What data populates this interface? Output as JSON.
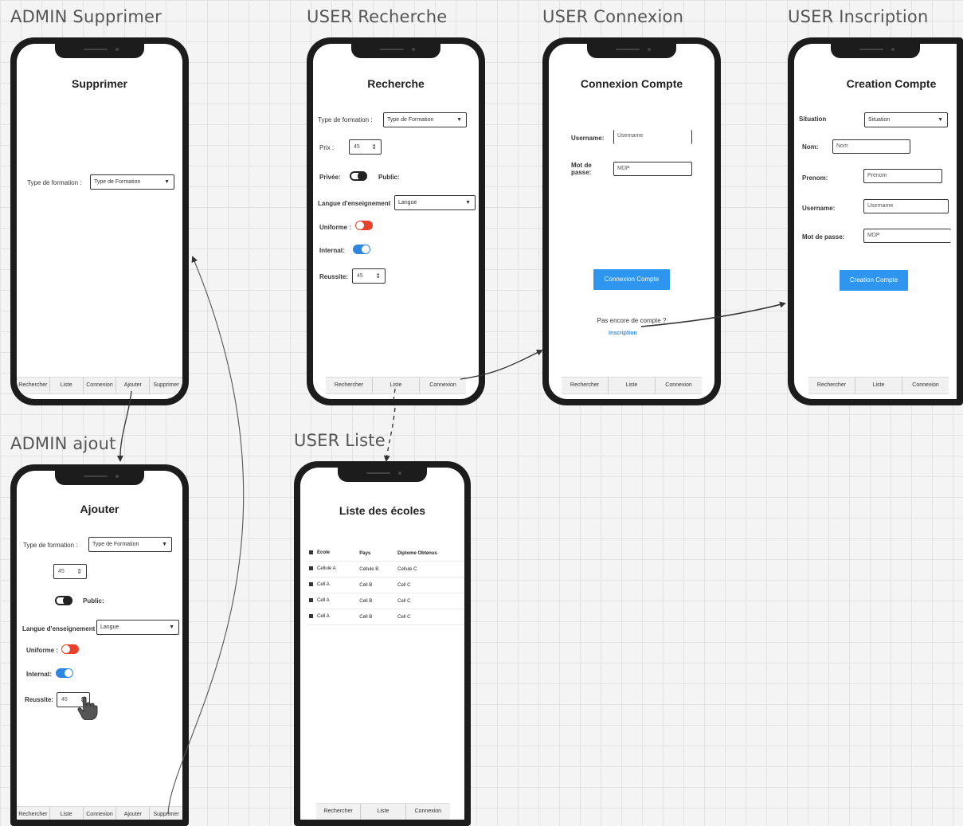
{
  "frames": {
    "admin_supprimer": {
      "label": "ADMIN Supprimer"
    },
    "user_recherche": {
      "label": "USER Recherche"
    },
    "user_connexion": {
      "label": "USER  Connexion"
    },
    "user_inscription": {
      "label": "USER  Inscription"
    },
    "admin_ajout": {
      "label": "ADMIN ajout"
    },
    "user_liste": {
      "label": "USER Liste"
    }
  },
  "supprimer": {
    "title": "Supprimer",
    "type_label": "Type de formation :",
    "type_value": "Type de Formation",
    "tabs": [
      "Rechercher",
      "Liste",
      "Connexion",
      "Ajouter",
      "Supprimer"
    ]
  },
  "recherche": {
    "title": "Recherche",
    "type_label": "Type de formation :",
    "type_value": "Type de Formation",
    "prix_label": "Prix :",
    "prix_value": "45",
    "privee_label": "Privée:",
    "public_label": "Public:",
    "langue_label": "Langue d'enseignement",
    "langue_value": "Langue",
    "uniforme_label": "Uniforme :",
    "internat_label": "Internat:",
    "reussite_label": "Reussite:",
    "reussite_value": "45",
    "tabs": [
      "Rechercher",
      "Liste",
      "Connexion"
    ]
  },
  "connexion": {
    "title": "Connexion Compte",
    "username_label": "Username:",
    "username_value": "Username",
    "password_label": "Mot de passe:",
    "password_value": "MDP",
    "button": "Connexion Compte",
    "no_account": "Pas encore de compte ?",
    "signup_link": "Inscription",
    "tabs": [
      "Rechercher",
      "Liste",
      "Connexion"
    ]
  },
  "inscription": {
    "title": "Creation Compte",
    "situation_label": "Situation",
    "situation_value": "Situation",
    "nom_label": "Nom:",
    "nom_value": "Nom",
    "prenom_label": "Prenom:",
    "prenom_value": "Prenom",
    "username_label": "Username:",
    "username_value": "Username",
    "password_label": "Mot de passe:",
    "password_value": "MDP",
    "button": "Creation Compte",
    "tabs": [
      "Rechercher",
      "Liste",
      "Connexion"
    ]
  },
  "ajouter": {
    "title": "Ajouter",
    "type_label": "Type de formation :",
    "type_value": "Type de Formation",
    "prix_value": "45",
    "public_label": "Public:",
    "langue_label": "Langue d'enseignement",
    "langue_value": "Langue",
    "uniforme_label": "Uniforme :",
    "internat_label": "Internat:",
    "reussite_label": "Reussite:",
    "reussite_value": "45",
    "tabs": [
      "Rechercher",
      "Liste",
      "Connexion",
      "Ajouter",
      "Supprimer"
    ]
  },
  "liste": {
    "title": "Liste des écoles",
    "headers": [
      "Ecole",
      "Pays",
      "Diplome Obtenus"
    ],
    "rows": [
      [
        "Cellule A",
        "Cellule B",
        "Cellule C"
      ],
      [
        "Cell A",
        "Cell B",
        "Cell C"
      ],
      [
        "Cell A",
        "Cell B",
        "Cell C"
      ],
      [
        "Cell A",
        "Cell B",
        "Cell C"
      ]
    ],
    "tabs": [
      "Rechercher",
      "Liste",
      "Connexion"
    ]
  },
  "colors": {
    "phone_frame": "#1c1c1c",
    "accent_blue": "#2f96f0",
    "toggle_red": "#e8412c",
    "toggle_blue": "#2f86e0",
    "canvas": "#f4f4f4"
  }
}
